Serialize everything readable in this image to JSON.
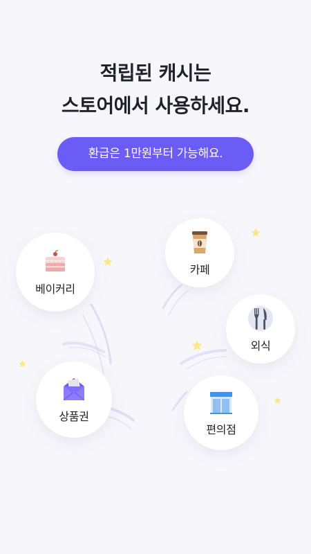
{
  "headline": {
    "line1": "적립된 캐시는",
    "line2": "스토어에서 사용하세요."
  },
  "refund_pill": {
    "label": "환급은 1만원부터 가능해요."
  },
  "categories": {
    "bakery": {
      "label": "베이커리",
      "icon": "cake-icon"
    },
    "cafe": {
      "label": "카페",
      "icon": "coffee-cup-icon"
    },
    "dining": {
      "label": "외식",
      "icon": "fork-knife-icon"
    },
    "gift": {
      "label": "상품권",
      "icon": "envelope-icon"
    },
    "store": {
      "label": "편의점",
      "icon": "storefront-icon"
    }
  },
  "colors": {
    "accent": "#6b5cf6",
    "background": "#f7f7fb",
    "star": "#fbe78a"
  }
}
